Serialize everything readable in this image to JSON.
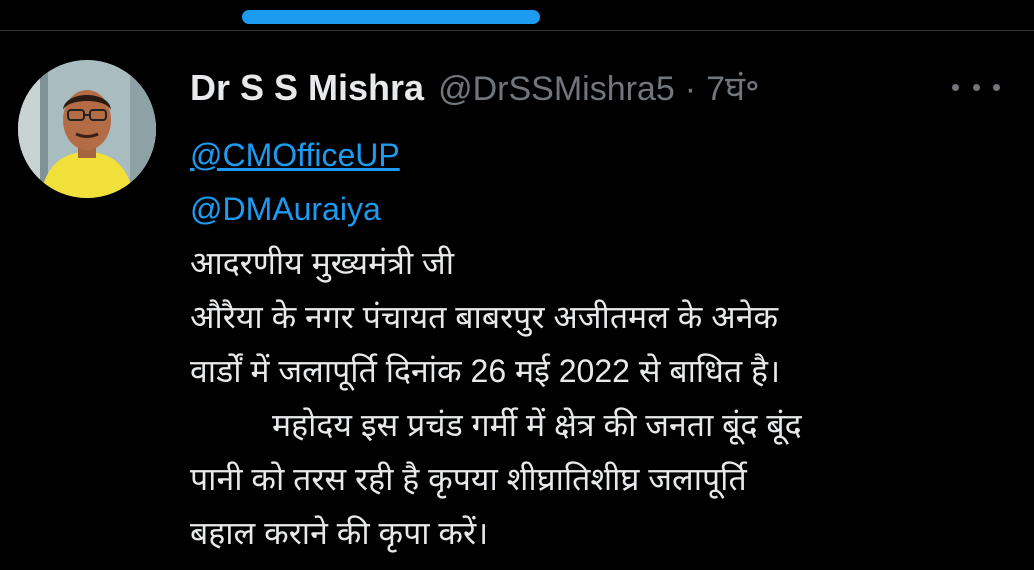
{
  "tweet": {
    "author": {
      "display_name": "Dr S S Mishra",
      "handle": "@DrSSMishra5",
      "separator": "·",
      "time": "7घं॰"
    },
    "more_icon": "more-horizontal-icon",
    "mentions": [
      "@CMOfficeUP",
      "@DMAuraiya"
    ],
    "lines": [
      "आदरणीय मुख्यमंत्री जी",
      "औरैया के नगर पंचायत बाबरपुर अजीतमल के अनेक",
      "वार्डों में जलापूर्ति दिनांक 26 मई 2022 से बाधित है।",
      "महोदय इस प्रचंड गर्मी में क्षेत्र की जनता बूंद बूंद",
      "पानी को तरस रही है कृपया शीघ्रातिशीघ्र जलापूर्ति",
      "बहाल कराने की कृपा करें।"
    ]
  },
  "colors": {
    "background": "#000000",
    "text": "#e7e9ea",
    "muted": "#71767b",
    "accent": "#1d9bf0"
  }
}
